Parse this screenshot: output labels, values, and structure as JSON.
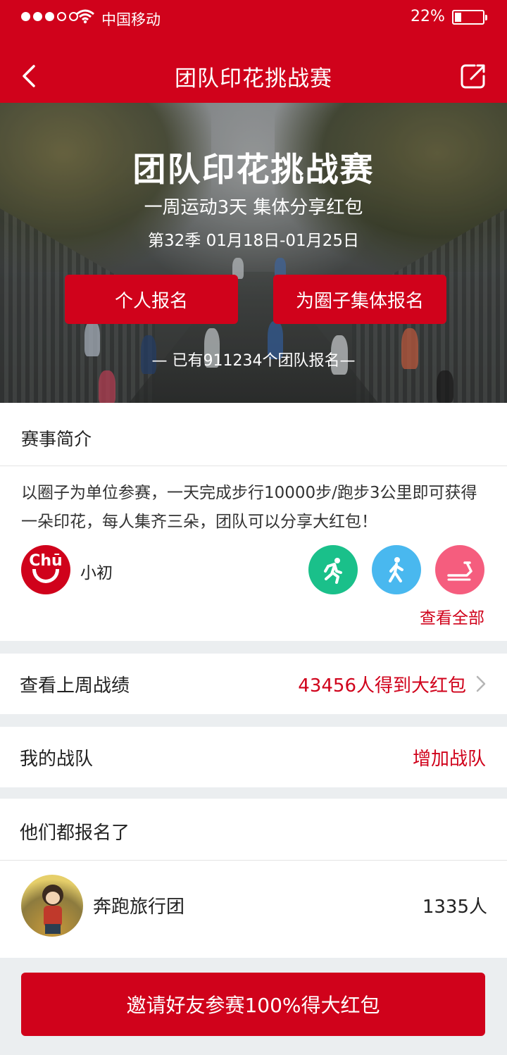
{
  "status_bar": {
    "carrier": "中国移动",
    "battery_percent": "22%",
    "battery_level": 0.22,
    "signal_bars_filled": 3,
    "signal_bars_total": 5,
    "icons": [
      "signal-icon",
      "wifi-icon",
      "battery-icon"
    ]
  },
  "nav": {
    "title": "团队印花挑战赛",
    "back_icon": "chevron-left-icon",
    "share_icon": "share-icon"
  },
  "hero": {
    "title": "团队印花挑战赛",
    "subtitle": "一周运动3天 集体分享红包",
    "season": "第32季 01月18日-01月25日",
    "personal_signup": "个人报名",
    "group_signup": "为圈子集体报名",
    "signup_count": "— 已有911234个团队报名—"
  },
  "intro": {
    "heading": "赛事简介",
    "text": "以圈子为单位参赛，一天完成步行10000步/跑步3公里即可获得一朵印花，每人集齐三朵，团队可以分享大红包！",
    "org_logo_text": "Chū",
    "org_name": "小初",
    "sports": [
      {
        "icon": "running-icon",
        "color": "#1ac08a"
      },
      {
        "icon": "walking-icon",
        "color": "#49b8ef"
      },
      {
        "icon": "treadmill-icon",
        "color": "#f55d7e"
      }
    ],
    "view_all": "查看全部"
  },
  "last_week": {
    "label": "查看上周战绩",
    "result": "43456人得到大红包"
  },
  "my_team": {
    "label": "我的战队",
    "action": "增加战队"
  },
  "joined": {
    "heading": "他们都报名了",
    "teams": [
      {
        "name": "奔跑旅行团",
        "count": "1335人"
      }
    ]
  },
  "invite_button": "邀请好友参赛100%得大红包",
  "colors": {
    "accent": "#d0021b",
    "background": "#ebeef0"
  }
}
